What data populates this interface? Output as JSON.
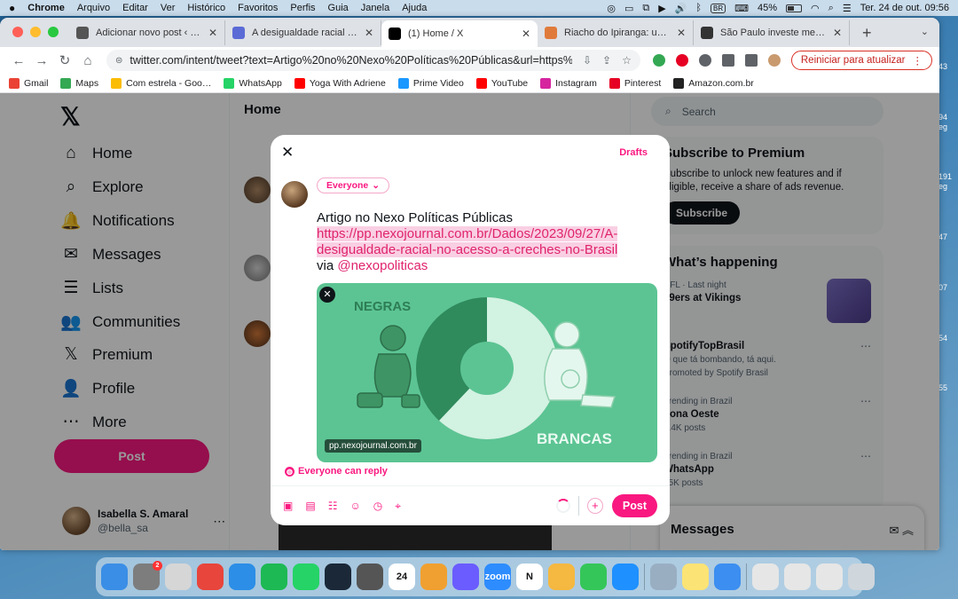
{
  "menubar": {
    "app": "Chrome",
    "menus": [
      "Arquivo",
      "Editar",
      "Ver",
      "Histórico",
      "Favoritos",
      "Perfis",
      "Guia",
      "Janela",
      "Ajuda"
    ],
    "input_source": "BR",
    "battery": "45%",
    "clock": "Ter. 24 de out.  09:56"
  },
  "tabs": [
    {
      "title": "Adicionar novo post ‹ Observa…",
      "favicon_color": "#555555"
    },
    {
      "title": "A desigualdade racial no aces…",
      "favicon_color": "#5b6bd6"
    },
    {
      "title": "(1) Home / X",
      "favicon_color": "#000000",
      "active": true
    },
    {
      "title": "Riacho do Ipiranga: uma teste…",
      "favicon_color": "#e07a3b"
    },
    {
      "title": "São Paulo investe menos de 2…",
      "favicon_color": "#333333"
    }
  ],
  "toolbar": {
    "url": "twitter.com/intent/tweet?text=Artigo%20no%20Nexo%20Políticas%20Públicas&url=https%3A%2F%2Fpp.nex…",
    "relaunch": "Reiniciar para atualizar"
  },
  "bookmarks": [
    {
      "label": "Gmail",
      "color": "#ea4335"
    },
    {
      "label": "Maps",
      "color": "#34a853"
    },
    {
      "label": "Com estrela - Goo…",
      "color": "#fbbc04"
    },
    {
      "label": "WhatsApp",
      "color": "#25d366"
    },
    {
      "label": "Yoga With Adriene",
      "color": "#ff0000"
    },
    {
      "label": "Prime Video",
      "color": "#1a98ff"
    },
    {
      "label": "YouTube",
      "color": "#ff0000"
    },
    {
      "label": "Instagram",
      "color": "#d6249f"
    },
    {
      "label": "Pinterest",
      "color": "#e60023"
    },
    {
      "label": "Amazon.com.br",
      "color": "#222222"
    }
  ],
  "sidebar": {
    "logo": "𝕏",
    "notifications_badge": "1",
    "items": [
      {
        "label": "Home",
        "icon": "⌂"
      },
      {
        "label": "Explore",
        "icon": "⌕"
      },
      {
        "label": "Notifications",
        "icon": "🔔"
      },
      {
        "label": "Messages",
        "icon": "✉"
      },
      {
        "label": "Lists",
        "icon": "☰"
      },
      {
        "label": "Communities",
        "icon": "👥"
      },
      {
        "label": "Premium",
        "icon": "𝕏"
      },
      {
        "label": "Profile",
        "icon": "👤"
      },
      {
        "label": "More",
        "icon": "⋯"
      }
    ],
    "post_button": "Post",
    "account": {
      "name": "Isabella S. Amaral",
      "handle": "@bella_sa"
    }
  },
  "feed": {
    "title": "Home"
  },
  "right": {
    "search_placeholder": "Search",
    "premium": {
      "title": "Subscribe to Premium",
      "text": "Subscribe to unlock new features and if eligible, receive a share of ads revenue.",
      "button": "Subscribe"
    },
    "happening_title": "What’s happening",
    "trends": [
      {
        "context": "NFL · Last night",
        "name": "49ers at Vikings",
        "meta": ""
      },
      {
        "context": "",
        "name": "SpotifyTopBrasil",
        "meta": "O que tá bombando, tá aqui.",
        "extra": "Promoted by Spotify Brasil"
      },
      {
        "context": "Trending in Brazil",
        "name": "Zona Oeste",
        "meta": "5.4K posts"
      },
      {
        "context": "Trending in Brazil",
        "name": "WhatsApp",
        "meta": "45K posts"
      }
    ],
    "messages_drawer": "Messages"
  },
  "compose": {
    "drafts": "Drafts",
    "audience": "Everyone",
    "text_line": "Artigo no Nexo Políticas Públicas",
    "link": "https://pp.nexojournal.com.br/Dados/2023/09/27/A-desigualdade-racial-no-acesso-a-creches-no-Brasil",
    "via_prefix": "via ",
    "mention": "@nexopoliticas",
    "card": {
      "label_left": "NEGRAS",
      "label_right": "BRANCAS",
      "domain": "pp.nexojournal.com.br",
      "bg": "#5cc493"
    },
    "reply_setting": "Everyone can reply",
    "post_button": "Post",
    "accent": "#f91880"
  },
  "wallpaper_edge": [
    "43",
    "94 eg",
    "191 eg",
    "47",
    "07",
    "54",
    "55"
  ],
  "dock": [
    {
      "name": "finder-icon",
      "color": "#3a8ee6"
    },
    {
      "name": "system-settings-icon",
      "color": "#7d7d7d",
      "badge": "2"
    },
    {
      "name": "launchpad-icon",
      "color": "#d6d6d6"
    },
    {
      "name": "chrome-icon",
      "color": "#e8453c"
    },
    {
      "name": "safari-icon",
      "color": "#2c8ee6"
    },
    {
      "name": "spotify-icon",
      "color": "#1db954"
    },
    {
      "name": "whatsapp-icon",
      "color": "#25d366"
    },
    {
      "name": "steam-icon",
      "color": "#1b2838"
    },
    {
      "name": "calculator-icon",
      "color": "#555555"
    },
    {
      "name": "calendar-icon",
      "color": "#ffffff",
      "label": "24"
    },
    {
      "name": "pages-icon",
      "color": "#f0a030"
    },
    {
      "name": "app-icon",
      "color": "#6a5cff"
    },
    {
      "name": "zoom-icon",
      "color": "#2d8cff",
      "label": "zoom"
    },
    {
      "name": "notion-icon",
      "color": "#ffffff",
      "label": "N"
    },
    {
      "name": "photos-icon",
      "color": "#f5b840"
    },
    {
      "name": "facetime-icon",
      "color": "#35c659"
    },
    {
      "name": "app-store-icon",
      "color": "#1e90ff"
    },
    {
      "name": "preview-icon",
      "color": "#9aaec2"
    },
    {
      "name": "notes-icon",
      "color": "#fce375"
    },
    {
      "name": "mail-icon",
      "color": "#3c8ef0"
    },
    {
      "name": "window-thumb-1-icon",
      "color": "#e6e6e6"
    },
    {
      "name": "window-thumb-2-icon",
      "color": "#e6e6e6"
    },
    {
      "name": "window-thumb-3-icon",
      "color": "#e6e6e6"
    },
    {
      "name": "trash-icon",
      "color": "#cfd6dc"
    }
  ]
}
